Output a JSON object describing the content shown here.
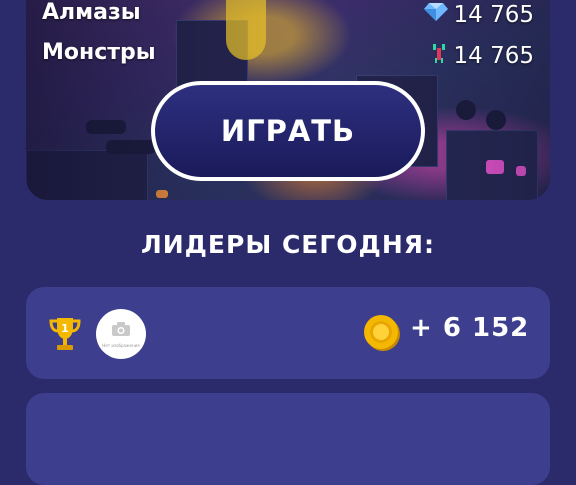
{
  "stats": [
    {
      "label": "Алмазы",
      "value": "14 765",
      "icon": "diamond-icon"
    },
    {
      "label": "Монстры",
      "value": "14 765",
      "icon": "monster-icon"
    }
  ],
  "play_button": {
    "label": "ИГРАТЬ"
  },
  "leaders": {
    "title": "ЛИДЕРЫ СЕГОДНЯ:",
    "rows": [
      {
        "rank": "1",
        "avatar_caption": "Нет изображения",
        "amount": "+ 6 152",
        "icon": "coin-icon"
      }
    ]
  },
  "colors": {
    "background": "#2b2a6b",
    "row_background": "#3d3f8e",
    "button_fill": "#1a1a5a",
    "coin": "#f2b705"
  }
}
